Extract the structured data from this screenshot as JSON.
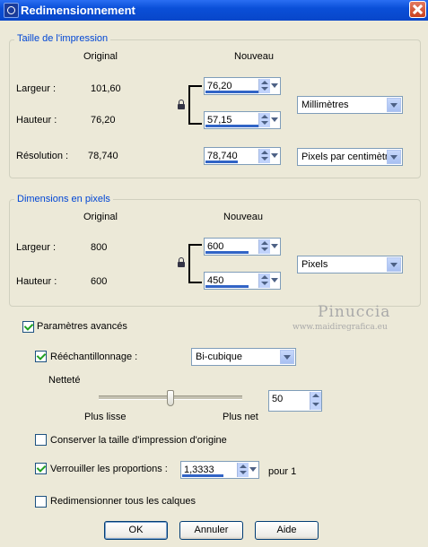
{
  "window": {
    "title": "Redimensionnement"
  },
  "print_size": {
    "legend": "Taille de l'impression",
    "col_original": "Original",
    "col_new": "Nouveau",
    "width_label": "Largeur :",
    "width_original": "101,60",
    "width_new": "76,20",
    "height_label": "Hauteur :",
    "height_original": "76,20",
    "height_new": "57,15",
    "unit": "Millimètres",
    "resolution_label": "Résolution :",
    "resolution_original": "78,740",
    "resolution_new": "78,740",
    "resolution_unit": "Pixels par centimètre"
  },
  "pixel_dimensions": {
    "legend": "Dimensions en pixels",
    "col_original": "Original",
    "col_new": "Nouveau",
    "width_label": "Largeur :",
    "width_original": "800",
    "width_new": "600",
    "height_label": "Hauteur :",
    "height_original": "600",
    "height_new": "450",
    "unit": "Pixels"
  },
  "advanced": {
    "label": "Paramètres avancés",
    "checked": true,
    "resample_label": "Rééchantillonnage :",
    "resample_checked": true,
    "resample_method": "Bi-cubique",
    "sharpness_label": "Netteté",
    "slider_left": "Plus lisse",
    "slider_right": "Plus net",
    "sharpness_value": "50",
    "sharpness_level": 0.5,
    "keep_print_size_label": "Conserver la taille d'impression d'origine",
    "keep_print_size_checked": false,
    "lock_ratio_label": "Verrouiller les proportions :",
    "lock_ratio_checked": true,
    "ratio_value": "1,3333",
    "ratio_suffix": "pour 1",
    "resize_all_layers_label": "Redimensionner tous les calques",
    "resize_all_layers_checked": false
  },
  "watermark": {
    "line1": "Pinuccia",
    "line2": "www.maidiregrafica.eu"
  },
  "buttons": {
    "ok": "OK",
    "cancel": "Annuler",
    "help": "Aide"
  }
}
